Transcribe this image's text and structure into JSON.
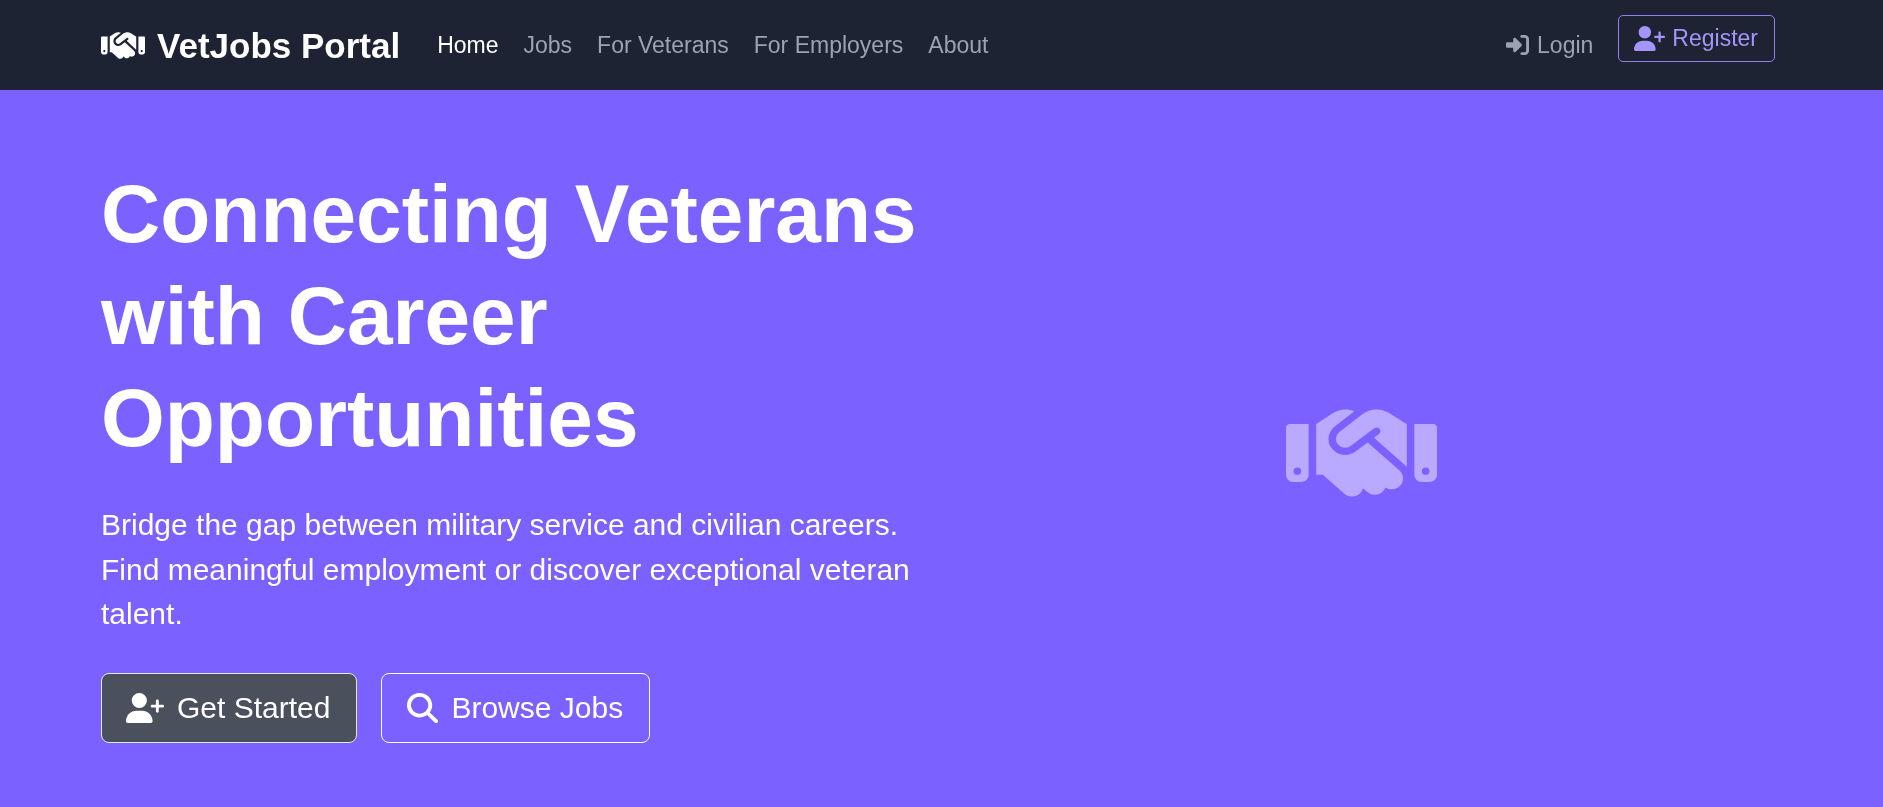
{
  "navbar": {
    "brand": "VetJobs Portal",
    "links": [
      {
        "label": "Home",
        "selected": true
      },
      {
        "label": "Jobs",
        "selected": false
      },
      {
        "label": "For Veterans",
        "selected": false
      },
      {
        "label": "For Employers",
        "selected": false
      },
      {
        "label": "About",
        "selected": false
      }
    ],
    "login": "Login",
    "register": "Register"
  },
  "hero": {
    "heading": "Connecting Veterans with Career Opportunities",
    "text": "Bridge the gap between military service and civilian careers. Find meaningful employment or discover exceptional veteran talent.",
    "buttons": [
      {
        "label": "Get Started",
        "kind": "primary"
      },
      {
        "label": "Browse Jobs",
        "kind": "outline"
      }
    ]
  }
}
